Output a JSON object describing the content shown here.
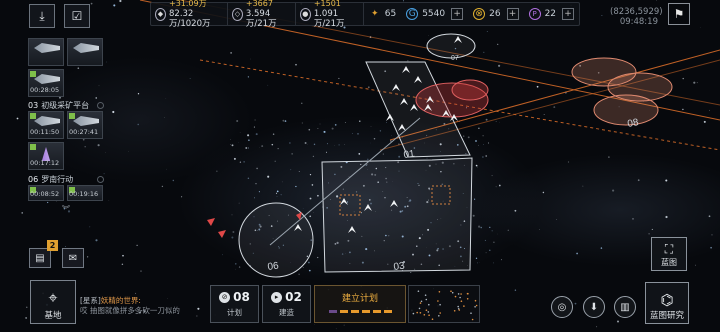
{
  "resources": [
    {
      "icon": "ore-icon",
      "glyph": "◆",
      "gain": "+31.09万",
      "amount": "82.32万/1020万"
    },
    {
      "icon": "crystal-icon",
      "glyph": "◇",
      "gain": "+3667",
      "amount": "3.594万/21万"
    },
    {
      "icon": "gas-icon",
      "glyph": "●",
      "gain": "+1501",
      "amount": "1.091万/21万"
    }
  ],
  "currencies": [
    {
      "icon": "energy-icon",
      "glyph": "✦",
      "value": "65",
      "color": "#e0a030",
      "plus": false
    },
    {
      "icon": "credits-icon",
      "glyph": "G",
      "value": "5540",
      "color": "#4aa0e0",
      "plus": true
    },
    {
      "icon": "alloy-icon",
      "glyph": "⊗",
      "value": "26",
      "color": "#e0b030",
      "plus": true
    },
    {
      "icon": "premium-icon",
      "glyph": "P",
      "value": "22",
      "color": "#b070e0",
      "plus": true
    }
  ],
  "coords": "(8236,5929)",
  "clock": "09:48:19",
  "fleets": {
    "timers_top": "00:28:05",
    "section1": {
      "num": "03",
      "name": "初级采矿平台"
    },
    "timers_s1": [
      "00:11:50",
      "00:27:41",
      "00:17:12"
    ],
    "section2": {
      "num": "06",
      "name": "罗南行动"
    },
    "timers_s2": [
      "00:08:52",
      "00:19:16"
    ]
  },
  "mail_badge": "2",
  "bottom": {
    "base_label": "基地",
    "chat_prefix": "[星系]",
    "chat_topic": "妖精的世界:",
    "chat_line2": "哎 抽图就像拼多多砍一刀似的",
    "plan_count": "08",
    "plan_label": "计划",
    "build_count": "02",
    "build_label": "建造",
    "build_plan_title": "建立计划",
    "blueprint_label": "蓝图",
    "research_label": "蓝图研究"
  },
  "map_labels": {
    "sector_01": "01",
    "sector_02": "02",
    "sector_03": "03",
    "sector_06": "06",
    "sector_08": "08",
    "sector_07": "07"
  }
}
